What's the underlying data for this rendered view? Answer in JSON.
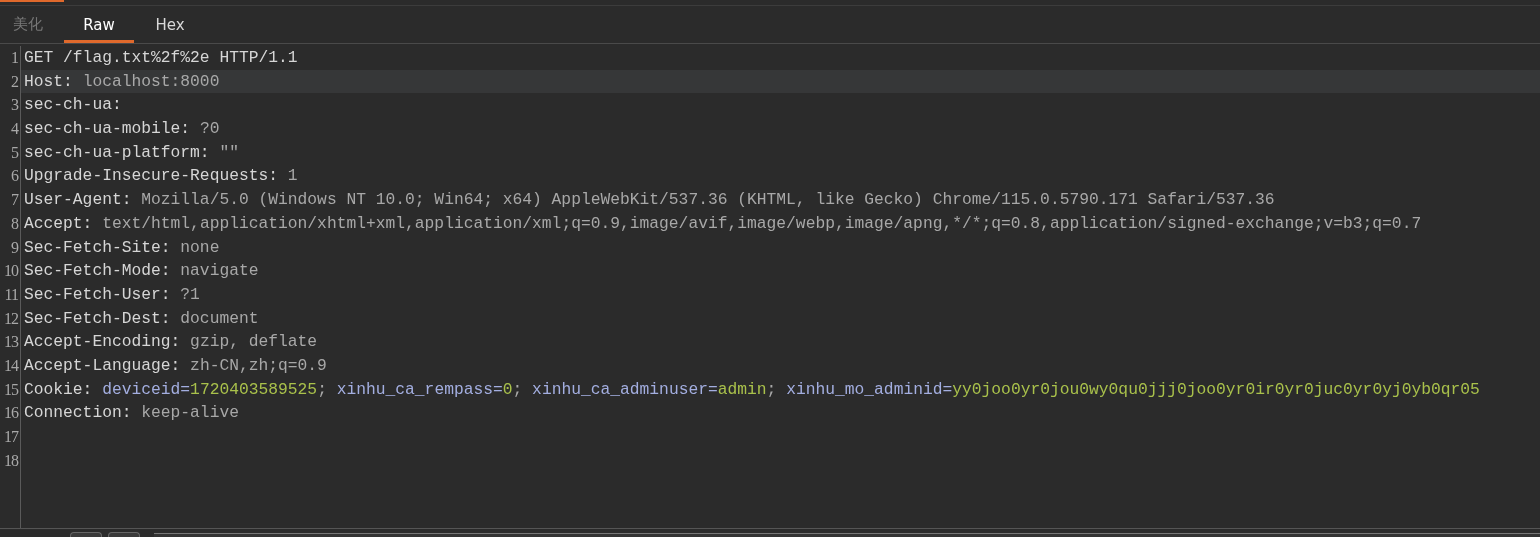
{
  "tabs": [
    {
      "label": "美化",
      "selected": false,
      "disabled": true
    },
    {
      "label": "Raw",
      "selected": true,
      "disabled": false
    },
    {
      "label": "Hex",
      "selected": false,
      "disabled": false
    }
  ],
  "editor": {
    "lines": [
      {
        "number": "1",
        "highlighted": false,
        "segments": [
          {
            "text": "GET /flag.txt%2f%2e HTTP/1.1",
            "kind": "name"
          }
        ]
      },
      {
        "number": "2",
        "highlighted": true,
        "segments": [
          {
            "text": "Host: ",
            "kind": "name"
          },
          {
            "text": "localhost:8000",
            "kind": "value"
          }
        ]
      },
      {
        "number": "3",
        "highlighted": false,
        "segments": [
          {
            "text": "sec-ch-ua:",
            "kind": "name"
          }
        ]
      },
      {
        "number": "4",
        "highlighted": false,
        "segments": [
          {
            "text": "sec-ch-ua-mobile: ",
            "kind": "name"
          },
          {
            "text": "?0",
            "kind": "value"
          }
        ]
      },
      {
        "number": "5",
        "highlighted": false,
        "segments": [
          {
            "text": "sec-ch-ua-platform: ",
            "kind": "name"
          },
          {
            "text": "\"\"",
            "kind": "value"
          }
        ]
      },
      {
        "number": "6",
        "highlighted": false,
        "segments": [
          {
            "text": "Upgrade-Insecure-Requests: ",
            "kind": "name"
          },
          {
            "text": "1",
            "kind": "value"
          }
        ]
      },
      {
        "number": "7",
        "highlighted": false,
        "segments": [
          {
            "text": "User-Agent: ",
            "kind": "name"
          },
          {
            "text": "Mozilla/5.0 (Windows NT 10.0; Win64; x64) AppleWebKit/537.36 (KHTML, like Gecko) Chrome/115.0.5790.171 Safari/537.36",
            "kind": "value"
          }
        ]
      },
      {
        "number": "8",
        "highlighted": false,
        "segments": [
          {
            "text": "Accept: ",
            "kind": "name"
          },
          {
            "text": "text/html,application/xhtml+xml,application/xml;q=0.9,image/avif,image/webp,image/apng,*/*;q=0.8,application/signed-exchange;v=b3;q=0.7",
            "kind": "value"
          }
        ]
      },
      {
        "number": "9",
        "highlighted": false,
        "segments": [
          {
            "text": "Sec-Fetch-Site: ",
            "kind": "name"
          },
          {
            "text": "none",
            "kind": "value"
          }
        ]
      },
      {
        "number": "10",
        "highlighted": false,
        "segments": [
          {
            "text": "Sec-Fetch-Mode: ",
            "kind": "name"
          },
          {
            "text": "navigate",
            "kind": "value"
          }
        ]
      },
      {
        "number": "11",
        "highlighted": false,
        "segments": [
          {
            "text": "Sec-Fetch-User: ",
            "kind": "name"
          },
          {
            "text": "?1",
            "kind": "value"
          }
        ]
      },
      {
        "number": "12",
        "highlighted": false,
        "segments": [
          {
            "text": "Sec-Fetch-Dest: ",
            "kind": "name"
          },
          {
            "text": "document",
            "kind": "value"
          }
        ]
      },
      {
        "number": "13",
        "highlighted": false,
        "segments": [
          {
            "text": "Accept-Encoding: ",
            "kind": "name"
          },
          {
            "text": "gzip, deflate",
            "kind": "value"
          }
        ]
      },
      {
        "number": "14",
        "highlighted": false,
        "segments": [
          {
            "text": "Accept-Language: ",
            "kind": "name"
          },
          {
            "text": "zh-CN,zh;q=0.9",
            "kind": "value"
          }
        ]
      },
      {
        "number": "15",
        "highlighted": false,
        "segments": [
          {
            "text": "Cookie: ",
            "kind": "name"
          },
          {
            "text": "deviceid=",
            "kind": "cookie-name"
          },
          {
            "text": "1720403589525",
            "kind": "cookie-value"
          },
          {
            "text": "; ",
            "kind": "value"
          },
          {
            "text": "xinhu_ca_rempass=",
            "kind": "cookie-name"
          },
          {
            "text": "0",
            "kind": "cookie-value"
          },
          {
            "text": "; ",
            "kind": "value"
          },
          {
            "text": "xinhu_ca_adminuser=",
            "kind": "cookie-name"
          },
          {
            "text": "admin",
            "kind": "cookie-value"
          },
          {
            "text": "; ",
            "kind": "value"
          },
          {
            "text": "xinhu_mo_adminid=",
            "kind": "cookie-name"
          },
          {
            "text": "yy0joo0yr0jou0wy0qu0jjj0joo0yr0ir0yr0juc0yr0yj0yb0qr05",
            "kind": "cookie-value"
          }
        ]
      },
      {
        "number": "16",
        "highlighted": false,
        "segments": [
          {
            "text": "Connection: ",
            "kind": "name"
          },
          {
            "text": "keep-alive",
            "kind": "value"
          }
        ]
      },
      {
        "number": "17",
        "highlighted": false
      },
      {
        "number": "18",
        "highlighted": false
      }
    ]
  }
}
